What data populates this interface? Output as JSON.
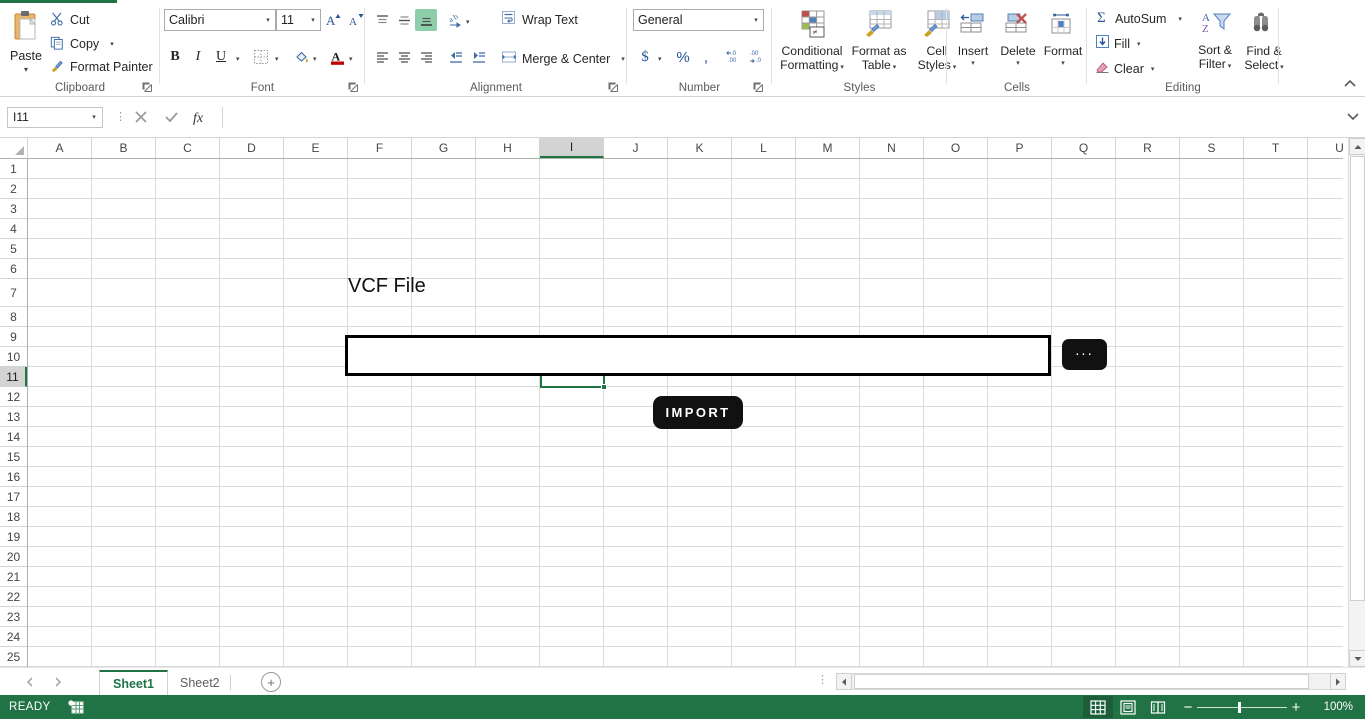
{
  "ribbon": {
    "active_tab_color": "#217346",
    "collapse_icon": "chevron-up-icon",
    "groups": [
      {
        "title": "Clipboard"
      },
      {
        "title": "Font"
      },
      {
        "title": "Alignment"
      },
      {
        "title": "Number"
      },
      {
        "title": "Styles"
      },
      {
        "title": "Cells"
      },
      {
        "title": "Editing"
      }
    ],
    "clipboard": {
      "paste_label": "Paste",
      "cut_label": "Cut",
      "copy_label": "Copy",
      "format_painter_label": "Format Painter"
    },
    "font": {
      "font_name": "Calibri",
      "font_size": "11",
      "grow_font_label": "A",
      "shrink_font_label": "A",
      "bold_label": "B",
      "italic_label": "I",
      "underline_label": "U"
    },
    "alignment": {
      "wrap_text_label": "Wrap Text",
      "merge_center_label": "Merge & Center"
    },
    "number": {
      "format_value": "General",
      "currency_label": "$",
      "percent_label": "%",
      "comma_label": ","
    },
    "styles": {
      "conditional_formatting_label": "Conditional\nFormatting",
      "conditional_formatting_line1": "Conditional",
      "conditional_formatting_line2": "Formatting",
      "format_as_table_line1": "Format as",
      "format_as_table_line2": "Table",
      "cell_styles_line1": "Cell",
      "cell_styles_line2": "Styles"
    },
    "cells": {
      "insert_label": "Insert",
      "delete_label": "Delete",
      "format_label": "Format"
    },
    "editing": {
      "autosum_label": "AutoSum",
      "fill_label": "Fill",
      "clear_label": "Clear",
      "sort_filter_line1": "Sort &",
      "sort_filter_line2": "Filter",
      "find_select_line1": "Find &",
      "find_select_line2": "Select"
    }
  },
  "formula_bar": {
    "name_box_value": "I11",
    "cancel_icon": "x-icon",
    "enter_icon": "check-icon",
    "function_icon": "fx-icon",
    "formula_value": "",
    "expand_icon": "chevron-down-icon"
  },
  "grid": {
    "columns": [
      "A",
      "B",
      "C",
      "D",
      "E",
      "F",
      "G",
      "H",
      "I",
      "J",
      "K",
      "L",
      "M",
      "N",
      "O",
      "P",
      "Q",
      "R",
      "S",
      "T",
      "U"
    ],
    "rows": [
      "1",
      "2",
      "3",
      "4",
      "5",
      "6",
      "7",
      "8",
      "9",
      "10",
      "11",
      "12",
      "13",
      "14",
      "15",
      "16",
      "17",
      "18",
      "19",
      "20",
      "21",
      "22",
      "23",
      "24",
      "25"
    ],
    "selected_column": "I",
    "selected_row": "11",
    "selected_cell": "I11",
    "selection_color": "#217346"
  },
  "form": {
    "label": "VCF File",
    "file_path_value": "",
    "file_path_placeholder": "",
    "browse_label": "...",
    "import_label": "IMPORT",
    "button_color": "#111111"
  },
  "sheet_tabs": {
    "tabs": [
      {
        "label": "Sheet1",
        "active": true
      },
      {
        "label": "Sheet2",
        "active": false
      }
    ],
    "add_sheet_label": "+",
    "prev_icon": "chevron-left-icon",
    "next_icon": "chevron-right-icon"
  },
  "status_bar": {
    "status_text": "READY",
    "macro_icon": "record-macro-icon",
    "views": [
      {
        "name": "normal-view",
        "icon": "grid-icon",
        "active": true
      },
      {
        "name": "page-layout-view",
        "icon": "page-icon",
        "active": false
      },
      {
        "name": "page-break-view",
        "icon": "pagebreak-icon",
        "active": false
      }
    ],
    "zoom_out_label": "−",
    "zoom_in_label": "+",
    "zoom_level": "100%"
  }
}
